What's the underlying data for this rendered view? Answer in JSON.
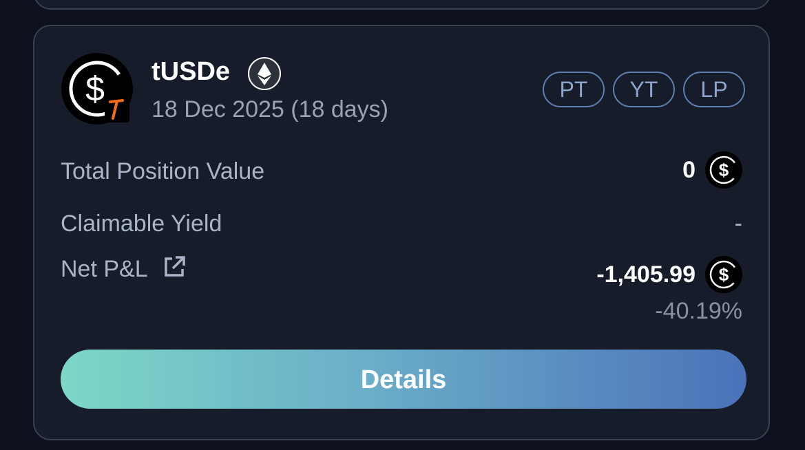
{
  "position": {
    "token_name": "tUSDe",
    "maturity": "18 Dec 2025 (18 days)",
    "chain_icon": "ethereum-icon",
    "token_icon": "usd-dollar-icon",
    "tags": [
      "PT",
      "YT",
      "LP"
    ],
    "rows": {
      "total_position_value": {
        "label": "Total Position Value",
        "value": "0"
      },
      "claimable_yield": {
        "label": "Claimable Yield",
        "value": "-"
      },
      "net_pnl": {
        "label": "Net P&L",
        "value": "-1,405.99",
        "percent": "-40.19%"
      }
    },
    "details_label": "Details"
  },
  "colors": {
    "background": "#0c111d",
    "card": "#161c2a",
    "pill_border": "#5f7fb3",
    "accent_orange": "#f26b1d",
    "button_gradient_start": "#7dd7c6",
    "button_gradient_end": "#4b72b9"
  }
}
